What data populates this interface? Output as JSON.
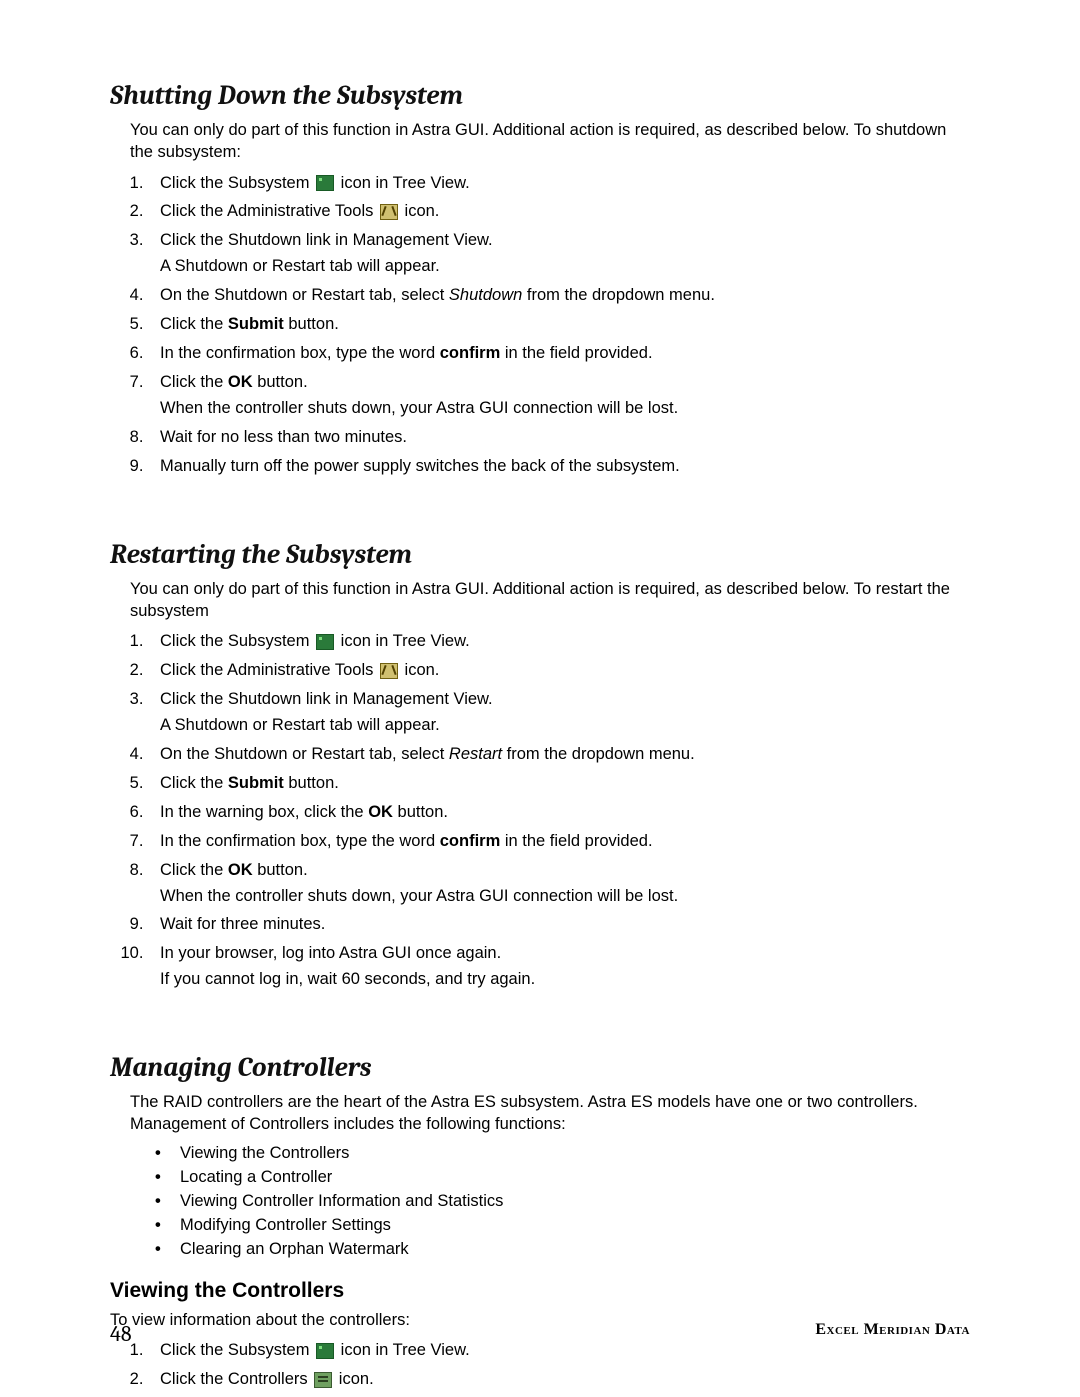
{
  "section1": {
    "title": "Shutting Down the Subsystem",
    "intro": "You can only do part of this function in Astra GUI. Additional action is required, as described below. To shutdown the subsystem:",
    "steps": {
      "s1a": "Click the Subsystem ",
      "s1b": " icon in Tree View.",
      "s2a": "Click the Administrative Tools ",
      "s2b": " icon.",
      "s3": "Click the Shutdown link in Management View.",
      "s3sub": "A Shutdown or Restart tab will appear.",
      "s4a": "On the Shutdown or Restart tab, select ",
      "s4i": "Shutdown",
      "s4b": " from the dropdown menu.",
      "s5a": "Click the ",
      "s5b": "Submit",
      "s5c": " button.",
      "s6a": "In the confirmation box, type the word ",
      "s6b": "confirm",
      "s6c": " in the field provided.",
      "s7a": "Click the ",
      "s7b": "OK",
      "s7c": " button.",
      "s7sub": "When the controller shuts down, your Astra GUI connection will be lost.",
      "s8": "Wait for no less than two minutes.",
      "s9": "Manually turn off the power supply switches the back of the subsystem."
    }
  },
  "section2": {
    "title": "Restarting the Subsystem",
    "intro": "You can only do part of this function in Astra GUI. Additional action is required, as described below. To restart the subsystem",
    "steps": {
      "s1a": "Click the Subsystem ",
      "s1b": " icon in Tree View.",
      "s2a": "Click the Administrative Tools ",
      "s2b": " icon.",
      "s3": "Click the Shutdown link in Management View.",
      "s3sub": "A Shutdown or Restart tab will appear.",
      "s4a": "On the Shutdown or Restart tab, select ",
      "s4i": "Restart",
      "s4b": " from the dropdown menu.",
      "s5a": "Click the ",
      "s5b": "Submit",
      "s5c": " button.",
      "s6a": "In the warning box, click the ",
      "s6b": "OK",
      "s6c": " button.",
      "s7a": "In the confirmation box, type the word ",
      "s7b": "confirm",
      "s7c": " in the field provided.",
      "s8a": "Click the ",
      "s8b": "OK",
      "s8c": " button.",
      "s8sub": "When the controller shuts down, your Astra GUI connection will be lost.",
      "s9": "Wait for three minutes.",
      "s10": "In your browser, log into Astra GUI once again.",
      "s10sub": "If you cannot log in, wait 60 seconds, and try again."
    }
  },
  "section3": {
    "title": "Managing Controllers",
    "intro": "The RAID controllers are the heart of the Astra ES subsystem. Astra ES models have one or two controllers. Management of Controllers includes the following functions:",
    "bullets": [
      "Viewing the Controllers",
      "Locating a Controller",
      "Viewing Controller Information and Statistics",
      "Modifying Controller Settings",
      "Clearing an Orphan Watermark"
    ],
    "sub": {
      "title": "Viewing the Controllers",
      "intro": "To view information about the controllers:",
      "s1a": "Click the Subsystem ",
      "s1b": " icon in Tree View.",
      "s2a": "Click the Controllers ",
      "s2b": " icon."
    }
  },
  "footer": {
    "page": "48",
    "brand": "Excel Meridian Data"
  }
}
